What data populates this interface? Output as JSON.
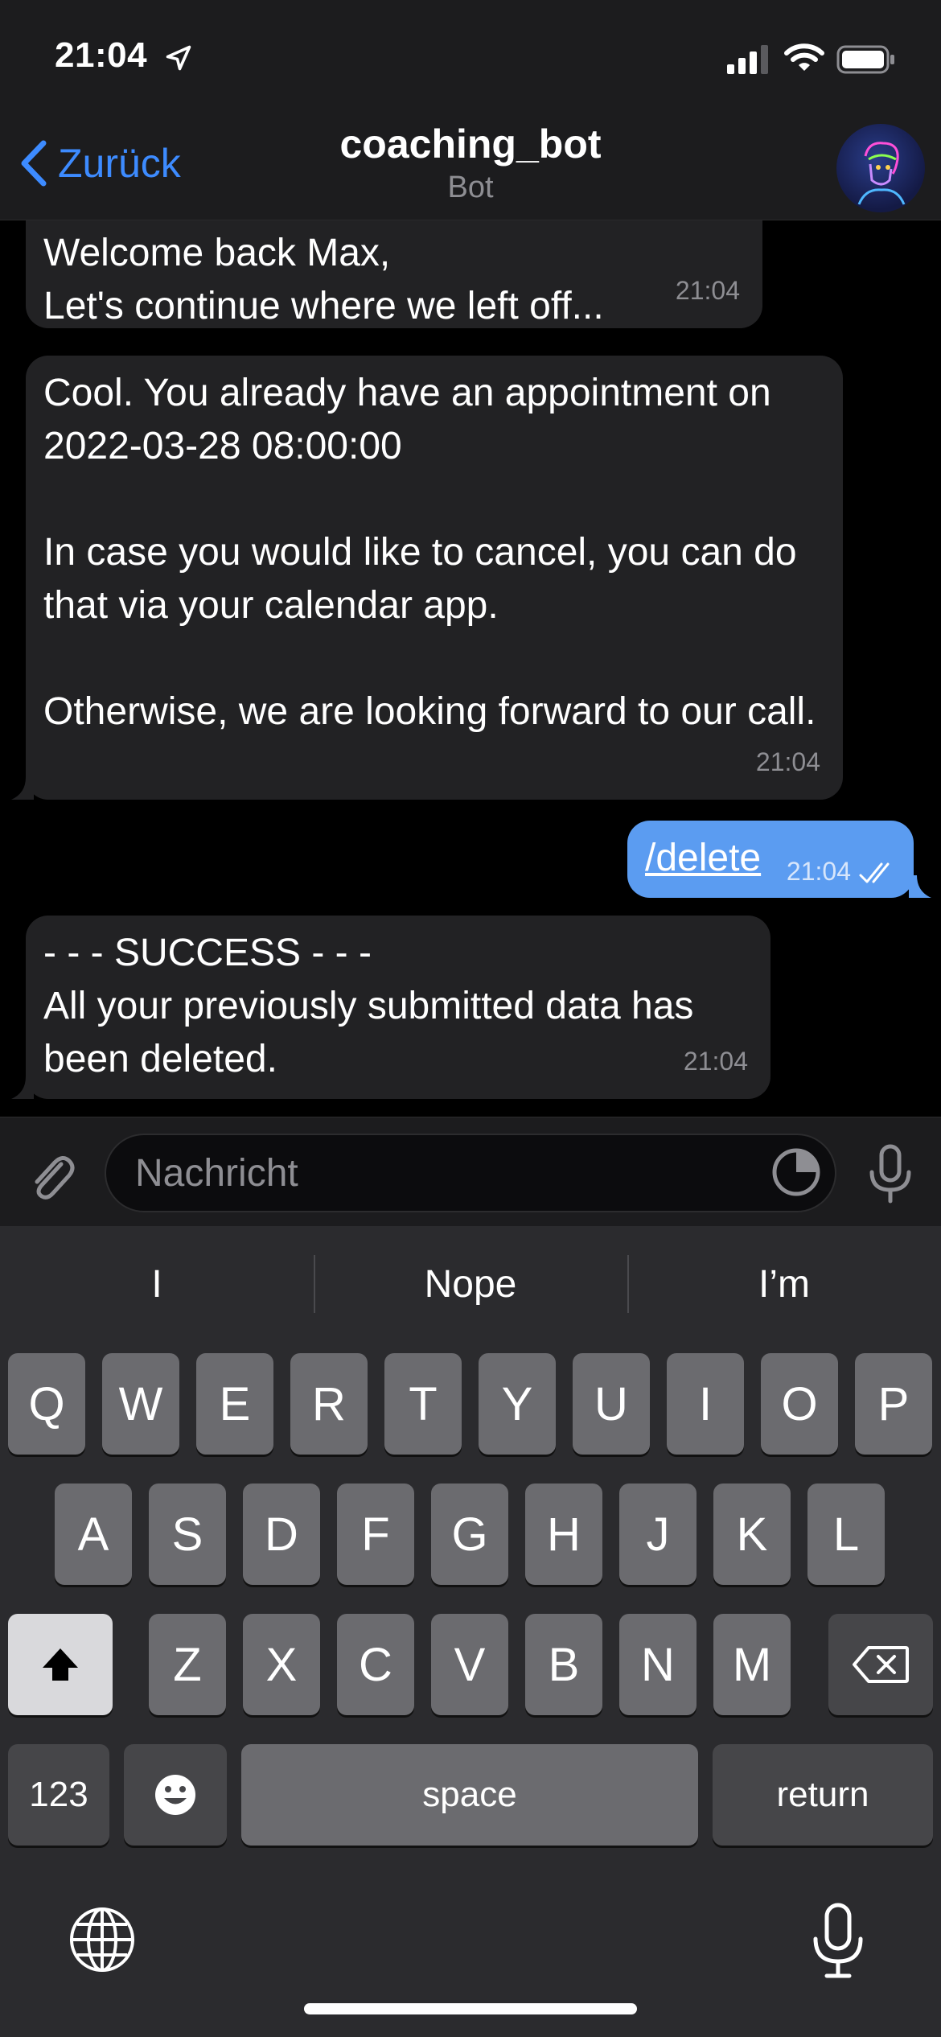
{
  "status_bar": {
    "time": "21:04"
  },
  "header": {
    "back_label": "Zurück",
    "title": "coaching_bot",
    "subtitle": "Bot"
  },
  "messages": [
    {
      "text": "Welcome back Max,\nLet's continue where we left off...",
      "time": "21:04"
    },
    {
      "text": "Cool. You already have an appointment on 2022-03-28 08:00:00\n\nIn case you would like to cancel, you can do that via your calendar app.\n\nOtherwise, we are looking forward to our call.",
      "time": "21:04"
    },
    {
      "text": "/delete",
      "time": "21:04"
    },
    {
      "text": "- - - SUCCESS - - -\nAll your previously submitted data has been deleted.",
      "time": "21:04"
    }
  ],
  "composer": {
    "placeholder": "Nachricht"
  },
  "keyboard": {
    "suggestions": [
      "I",
      "Nope",
      "I’m"
    ],
    "row1": [
      "Q",
      "W",
      "E",
      "R",
      "T",
      "Y",
      "U",
      "I",
      "O",
      "P"
    ],
    "row2": [
      "A",
      "S",
      "D",
      "F",
      "G",
      "H",
      "J",
      "K",
      "L"
    ],
    "row3": [
      "Z",
      "X",
      "C",
      "V",
      "B",
      "N",
      "M"
    ],
    "numbers_label": "123",
    "space_label": "space",
    "return_label": "return"
  },
  "colors": {
    "accent": "#3d8bff",
    "outgoing_bubble": "#5b9cf1",
    "incoming_bubble": "#222224",
    "keyboard_bg": "#2b2b2e"
  }
}
